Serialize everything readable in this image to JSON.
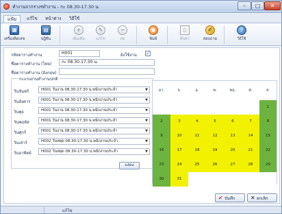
{
  "window": {
    "title": "ทำงานจากรางรทำงาน - กะ 08.30-17.30 น.",
    "controls": {
      "minimize": "–",
      "maximize": "□",
      "close": "✕"
    }
  },
  "menu": {
    "tabs": [
      "แฟ้ม",
      "แก้ไข",
      "หน้าต่าง",
      "วิธีใช้"
    ],
    "active_index": 0
  },
  "ribbon": {
    "buttons": [
      {
        "label": "เครื่องคิดเลข",
        "icon": "calculator-icon",
        "glyph": "▦",
        "enabled": true
      },
      {
        "label": "ปฏิทิน",
        "icon": "calendar-icon",
        "glyph": "▤",
        "enabled": true
      },
      {
        "label": "เพิ่มเติม",
        "icon": "add-icon",
        "glyph": "+",
        "enabled": false
      },
      {
        "label": "แก้ไข",
        "icon": "edit-icon",
        "glyph": "✎",
        "enabled": false
      },
      {
        "label": "ลบ",
        "icon": "delete-icon",
        "glyph": "−",
        "enabled": false
      },
      {
        "label": "พิมพ์",
        "icon": "print-icon",
        "glyph": "◉",
        "enabled": true
      },
      {
        "label": "ค้นหา",
        "icon": "search-icon",
        "glyph": "▯",
        "enabled": false
      },
      {
        "label": "สอบถาม",
        "icon": "inquiry-icon",
        "glyph": "✐",
        "enabled": true
      },
      {
        "label": "วิธีใช้",
        "icon": "help-icon",
        "glyph": "?",
        "enabled": true
      }
    ]
  },
  "form": {
    "code_label": "รหัสตารางทำงาน",
    "code_value": "H001",
    "in_use_label": "ยังใช้งาน",
    "in_use_checked": true,
    "name_th_label": "ชื่อตารางทำงาน (ไทย)",
    "name_th_value": "กะ 08.30-17.30 น.",
    "name_en_label": "ชื่อตารางทำงาน (อังกฤษ)",
    "name_en_value": "",
    "weekly_group_label": "กะแรงงานทำงานปกติ",
    "days": [
      {
        "label": "วันจันทร์",
        "value": "H001 วันงาน 08.30-17.30 น.พนักงานประจำ"
      },
      {
        "label": "วันอังคาร",
        "value": "H001 วันงาน 08.30-17.30 น.พนักงานประจำ"
      },
      {
        "label": "วันพุธ",
        "value": "H001 วันงาน 08.30-17.30 น.พนักงานประจำ"
      },
      {
        "label": "วันพฤหัส",
        "value": "H001 วันงาน 08.30-17.30 น.พนักงานประจำ"
      },
      {
        "label": "วันศุกร์",
        "value": "H001 วันงาน 08.30-17.30 น.พนักงานประจำ"
      },
      {
        "label": "วันเสาร์",
        "value": "H002 วันหยุด 08.30-17.30 น.พนักงานประจำ"
      },
      {
        "label": "วันอาทิตย์",
        "value": "H002 วันหยุด 08.30-17.30 น.พนักงานประจำ"
      }
    ],
    "show_button": "แสดง"
  },
  "calendar": {
    "headers": [
      "อา.",
      "จ.",
      "อ.",
      "พ.",
      "พฤ.",
      "ศ.",
      "ส."
    ],
    "weeks": [
      [
        {
          "d": "",
          "t": "e"
        },
        {
          "d": "",
          "t": "e"
        },
        {
          "d": "",
          "t": "e"
        },
        {
          "d": "",
          "t": "e"
        },
        {
          "d": "",
          "t": "e"
        },
        {
          "d": "",
          "t": "e"
        },
        {
          "d": "1",
          "t": "h"
        }
      ],
      [
        {
          "d": "2",
          "t": "h"
        },
        {
          "d": "3",
          "t": "w"
        },
        {
          "d": "4",
          "t": "w"
        },
        {
          "d": "5",
          "t": "w"
        },
        {
          "d": "6",
          "t": "w"
        },
        {
          "d": "7",
          "t": "w"
        },
        {
          "d": "8",
          "t": "h"
        }
      ],
      [
        {
          "d": "9",
          "t": "h"
        },
        {
          "d": "10",
          "t": "w"
        },
        {
          "d": "11",
          "t": "w"
        },
        {
          "d": "12",
          "t": "w"
        },
        {
          "d": "13",
          "t": "w"
        },
        {
          "d": "14",
          "t": "w"
        },
        {
          "d": "15",
          "t": "h"
        }
      ],
      [
        {
          "d": "16",
          "t": "h"
        },
        {
          "d": "17",
          "t": "w"
        },
        {
          "d": "18",
          "t": "w"
        },
        {
          "d": "19",
          "t": "w"
        },
        {
          "d": "20",
          "t": "w"
        },
        {
          "d": "21",
          "t": "w"
        },
        {
          "d": "22",
          "t": "h"
        }
      ],
      [
        {
          "d": "23",
          "t": "h"
        },
        {
          "d": "24",
          "t": "w"
        },
        {
          "d": "25",
          "t": "w"
        },
        {
          "d": "26",
          "t": "w"
        },
        {
          "d": "27",
          "t": "w"
        },
        {
          "d": "28",
          "t": "w"
        },
        {
          "d": "29",
          "t": "h"
        }
      ],
      [
        {
          "d": "30",
          "t": "h"
        },
        {
          "d": "31",
          "t": "w"
        },
        {
          "d": "",
          "t": "e"
        },
        {
          "d": "",
          "t": "e"
        },
        {
          "d": "",
          "t": "e"
        },
        {
          "d": "",
          "t": "e"
        },
        {
          "d": "",
          "t": "e"
        }
      ]
    ],
    "colors": {
      "workday": "#f2f200",
      "holiday": "#6cb33f"
    }
  },
  "footer": {
    "save_label": "บันทึก",
    "save_icon": "✔",
    "cancel_label": "ยกเลิก",
    "cancel_icon": "✕"
  },
  "statusbar": {
    "text": "แก้ไข"
  }
}
